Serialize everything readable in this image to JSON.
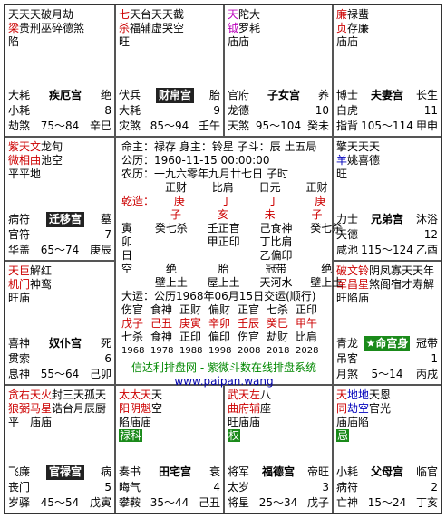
{
  "cells": [
    {
      "id": "si",
      "stars": [
        [
          {
            "t": "天天天破月劫",
            "c": "k"
          }
        ],
        [
          {
            "t": "梁",
            "c": "r"
          },
          {
            "t": "贵刑巫碎德煞",
            "c": "k"
          }
        ],
        [
          {
            "t": "陷",
            "c": "k"
          }
        ]
      ],
      "l1": [
        "大耗",
        "疾厄宫",
        "绝"
      ],
      "l2": [
        "小耗",
        "",
        "8"
      ],
      "l3": [
        "劫煞",
        "75～84",
        "辛巳"
      ],
      "palace_style": "plain"
    },
    {
      "id": "wu",
      "stars": [
        [
          {
            "t": "七",
            "c": "r"
          },
          {
            "t": "天台天天截",
            "c": "k"
          }
        ],
        [
          {
            "t": "杀",
            "c": "r"
          },
          {
            "t": "福辅虚哭空",
            "c": "k"
          }
        ],
        [
          {
            "t": "旺",
            "c": "k"
          }
        ]
      ],
      "l1": [
        "伏兵",
        "财帛宫",
        "胎"
      ],
      "l2": [
        "大耗",
        "",
        "9"
      ],
      "l3": [
        "灾煞",
        "85～94",
        "壬午"
      ],
      "palace_style": "dark"
    },
    {
      "id": "wei",
      "stars": [
        [
          {
            "t": "天",
            "c": "m"
          },
          {
            "t": "陀大",
            "c": "k"
          }
        ],
        [
          {
            "t": "钺",
            "c": "m"
          },
          {
            "t": "罗耗",
            "c": "k"
          }
        ],
        [
          {
            "t": "庙庙",
            "c": "k"
          }
        ]
      ],
      "l1": [
        "官府",
        "子女宫",
        "养"
      ],
      "l2": [
        "龙德",
        "",
        "10"
      ],
      "l3": [
        "天煞",
        "95～104",
        "癸未"
      ],
      "palace_style": "plain"
    },
    {
      "id": "shen",
      "stars": [
        [
          {
            "t": "廉",
            "c": "r"
          },
          {
            "t": "禄蜚",
            "c": "k"
          }
        ],
        [
          {
            "t": "贞",
            "c": "r"
          },
          {
            "t": "存廉",
            "c": "k"
          }
        ],
        [
          {
            "t": "庙庙",
            "c": "k"
          }
        ]
      ],
      "l1": [
        "博士",
        "夫妻宫",
        "长生"
      ],
      "l2": [
        "白虎",
        "",
        "11"
      ],
      "l3": [
        "指背",
        "105～114",
        "甲申"
      ],
      "palace_style": "plain"
    },
    {
      "id": "chen",
      "stars": [
        [
          {
            "t": "紫天文",
            "c": "r"
          },
          {
            "t": "龙旬",
            "c": "k"
          }
        ],
        [
          {
            "t": "微相曲",
            "c": "r"
          },
          {
            "t": "池空",
            "c": "k"
          }
        ],
        [
          {
            "t": "平平地",
            "c": "k"
          }
        ]
      ],
      "l1": [
        "病符",
        "迁移宫",
        "墓"
      ],
      "l2": [
        "官符",
        "",
        "7"
      ],
      "l3": [
        "华盖",
        "65～74",
        "庚辰"
      ],
      "palace_style": "dark"
    },
    {
      "id": "you",
      "stars": [
        [
          {
            "t": "擎天天天",
            "c": "k"
          }
        ],
        [
          {
            "t": "羊",
            "c": "b"
          },
          {
            "t": "姚喜德",
            "c": "k"
          }
        ],
        [
          {
            "t": "旺",
            "c": "k"
          }
        ]
      ],
      "l1": [
        "力士",
        "兄弟宫",
        "沐浴"
      ],
      "l2": [
        "天德",
        "",
        "12"
      ],
      "l3": [
        "咸池",
        "115～124",
        "乙酉"
      ],
      "palace_style": "plain"
    },
    {
      "id": "mao",
      "stars": [
        [
          {
            "t": "天巨",
            "c": "r"
          },
          {
            "t": "解红",
            "c": "k"
          }
        ],
        [
          {
            "t": "机门",
            "c": "r"
          },
          {
            "t": "神鸾",
            "c": "k"
          }
        ],
        [
          {
            "t": "旺庙",
            "c": "k"
          }
        ]
      ],
      "l1": [
        "喜神",
        "奴仆宫",
        "死"
      ],
      "l2": [
        "贯索",
        "",
        "6"
      ],
      "l3": [
        "息神",
        "55～64",
        "己卯"
      ],
      "palace_style": "plain"
    },
    {
      "id": "xu",
      "stars": [
        [
          {
            "t": "破文铃",
            "c": "r"
          },
          {
            "t": "阴凤寡天天年",
            "c": "k"
          }
        ],
        [
          {
            "t": "军昌星",
            "c": "r"
          },
          {
            "t": "煞阁宿才寿解",
            "c": "k"
          }
        ],
        [
          {
            "t": "旺陷庙",
            "c": "k"
          }
        ]
      ],
      "l1": [
        "青龙",
        "命宫",
        "冠带"
      ],
      "l2": [
        "吊客",
        "",
        "1"
      ],
      "l3": [
        "月煞",
        "5～14",
        "丙戌"
      ],
      "palace_style": "ming"
    },
    {
      "id": "yin",
      "stars": [
        [
          {
            "t": "贪右天火",
            "c": "r"
          },
          {
            "t": "封三天孤天",
            "c": "k"
          }
        ],
        [
          {
            "t": "狼弼马星",
            "c": "r"
          },
          {
            "t": "诰台月辰厨",
            "c": "k"
          }
        ],
        [
          {
            "t": "平　庙庙",
            "c": "k"
          }
        ]
      ],
      "l1": [
        "飞廉",
        "官禄宫",
        "病"
      ],
      "l2": [
        "丧门",
        "",
        "5"
      ],
      "l3": [
        "岁驿",
        "45～54",
        "戊寅"
      ],
      "palace_style": "dark"
    },
    {
      "id": "chou",
      "stars": [
        [
          {
            "t": "太太天",
            "c": "r"
          },
          {
            "t": "天",
            "c": "k"
          }
        ],
        [
          {
            "t": "阳阴魁",
            "c": "r"
          },
          {
            "t": "空",
            "c": "k"
          }
        ],
        [
          {
            "t": "陷庙庙",
            "c": "k"
          }
        ],
        [
          {
            "t": "禄科",
            "c": "hl"
          }
        ]
      ],
      "l1": [
        "奏书",
        "田宅宫",
        "衰"
      ],
      "l2": [
        "晦气",
        "",
        "4"
      ],
      "l3": [
        "攀鞍",
        "35～44",
        "己丑"
      ],
      "palace_style": "plain"
    },
    {
      "id": "zi",
      "stars": [
        [
          {
            "t": "武天左",
            "c": "r"
          },
          {
            "t": "八",
            "c": "k"
          }
        ],
        [
          {
            "t": "曲府辅",
            "c": "r"
          },
          {
            "t": "座",
            "c": "k"
          }
        ],
        [
          {
            "t": "旺庙庙",
            "c": "k"
          }
        ],
        [
          {
            "t": "权",
            "c": "hl"
          }
        ]
      ],
      "l1": [
        "将军",
        "福德宫",
        "帝旺"
      ],
      "l2": [
        "太岁",
        "",
        "3"
      ],
      "l3": [
        "将星",
        "25～34",
        "戊子"
      ],
      "palace_style": "plain"
    },
    {
      "id": "hai",
      "stars": [
        [
          {
            "t": "天",
            "c": "r"
          },
          {
            "t": "地地",
            "c": "b"
          },
          {
            "t": "天恩",
            "c": "k"
          }
        ],
        [
          {
            "t": "同",
            "c": "r"
          },
          {
            "t": "劫空",
            "c": "b"
          },
          {
            "t": "官光",
            "c": "k"
          }
        ],
        [
          {
            "t": "庙庙陷",
            "c": "k"
          }
        ],
        [
          {
            "t": "忌",
            "c": "hl"
          }
        ]
      ],
      "l1": [
        "小耗",
        "父母宫",
        "临官"
      ],
      "l2": [
        "病符",
        "",
        "2"
      ],
      "l3": [
        "亡神",
        "15～24",
        "丁亥"
      ],
      "palace_style": "plain"
    }
  ],
  "center": {
    "line1": "命主：禄存 身主：铃星 子斗：辰 土五局",
    "line2": "公历：1960-11-15 00:00:00",
    "line3": "农历：一九六零年九月廿七日 子时",
    "pillar_titles": [
      "正财",
      "比肩",
      "日元",
      "正财"
    ],
    "gan_label": "乾造：",
    "gan": [
      "庚",
      "丁",
      "丁",
      "庚"
    ],
    "zhi": [
      "子",
      "亥",
      "未",
      "子"
    ],
    "hidden": [
      [
        "寅",
        "癸七杀",
        "壬正官",
        "己食神",
        "癸七杀"
      ],
      [
        "卯",
        "",
        "甲正印",
        "丁比肩",
        ""
      ],
      [
        "日",
        "",
        "",
        "乙偏印",
        ""
      ],
      [
        "空",
        "绝",
        "胎",
        "冠带",
        "绝"
      ]
    ],
    "shensha": [
      "",
      "壁上土",
      "屋上土",
      "天河水",
      "壁上土"
    ],
    "dayun": "大运：公历1968年06月15日交运(顺行)",
    "dy_shishen": [
      "伤官",
      "食神",
      "正财",
      "偏财",
      "正官",
      "七杀",
      "正印"
    ],
    "dy_ganzhi": [
      "戊子",
      "己丑",
      "庚寅",
      "辛卯",
      "壬辰",
      "癸巳",
      "甲午"
    ],
    "dy_zhi_shishen": [
      "七杀",
      "食神",
      "正印",
      "偏印",
      "伤官",
      "劫财",
      "比肩"
    ],
    "dy_years": [
      "1968",
      "1978",
      "1988",
      "1998",
      "2008",
      "2018",
      "2028"
    ],
    "website": "信达利排盘网 - 紫微斗数在线排盘系统",
    "url": "www.paipan.wang"
  }
}
